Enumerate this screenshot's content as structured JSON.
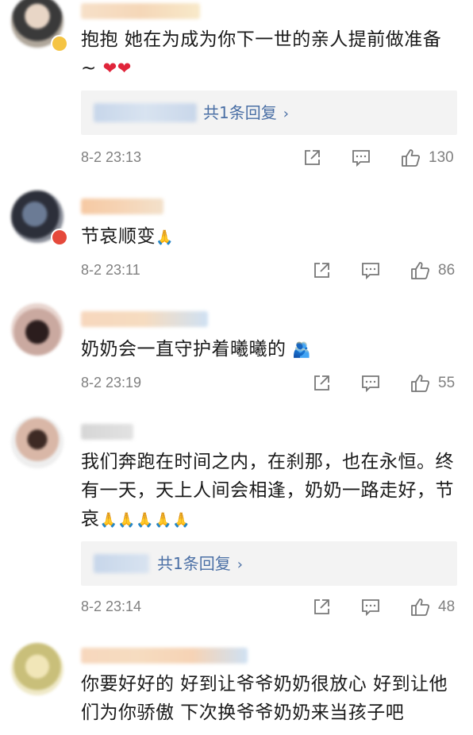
{
  "comments": [
    {
      "text": "抱抱 她在为成为你下一世的亲人提前做准备 ~",
      "emoji": "❤❤",
      "reply_label": "共1条回复",
      "time": "8-2 23:13",
      "likes": "130"
    },
    {
      "text": "节哀顺变",
      "emoji": "🙏",
      "time": "8-2 23:11",
      "likes": "86"
    },
    {
      "text": "奶奶会一直守护着曦曦的",
      "emoji": "🫂",
      "time": "8-2 23:19",
      "likes": "55"
    },
    {
      "text": "我们奔跑在时间之内，在刹那，也在永恒。终有一天，天上人间会相逢，奶奶一路走好，节哀",
      "emoji": "🙏🙏🙏🙏🙏",
      "reply_label": "共1条回复",
      "time": "8-2 23:14",
      "likes": "48"
    },
    {
      "text": "你要好好的 好到让爷爷奶奶很放心 好到让他们为你骄傲 下次换爷爷奶奶来当孩子吧"
    }
  ],
  "icons": {
    "share": "share-icon",
    "comment": "comment-icon",
    "like": "thumbs-up-icon",
    "chevron": "chevron-right-icon"
  },
  "colors": {
    "link": "#4a6fa5",
    "meta_text": "#808080",
    "reply_bg": "#f3f3f3"
  }
}
